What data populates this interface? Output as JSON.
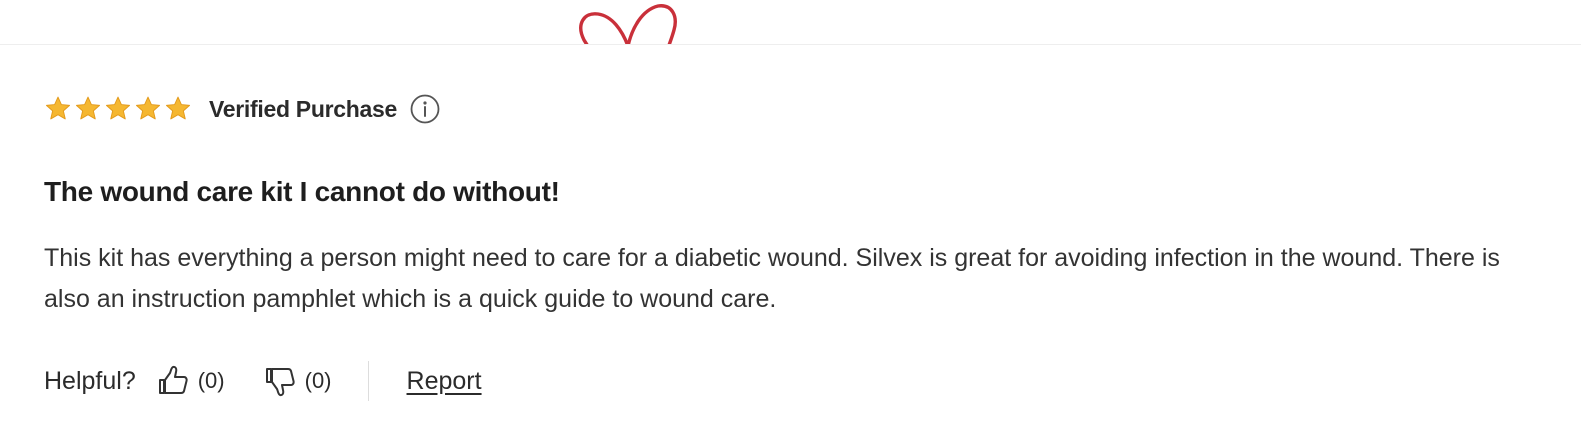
{
  "review": {
    "rating": 5,
    "rating_max": 5,
    "star_color": "#f5b731",
    "verified_label": "Verified Purchase",
    "title": "The wound care kit I cannot do without!",
    "body": "This kit has everything a person might need to care for a diabetic wound. Silvex is great for avoiding infection in the wound. There is also an instruction pamphlet which is a quick guide to wound care.",
    "helpful_label": "Helpful?",
    "upvotes": "(0)",
    "downvotes": "(0)",
    "report_label": "Report"
  },
  "decoration": {
    "heart_color": "#c9303a"
  }
}
